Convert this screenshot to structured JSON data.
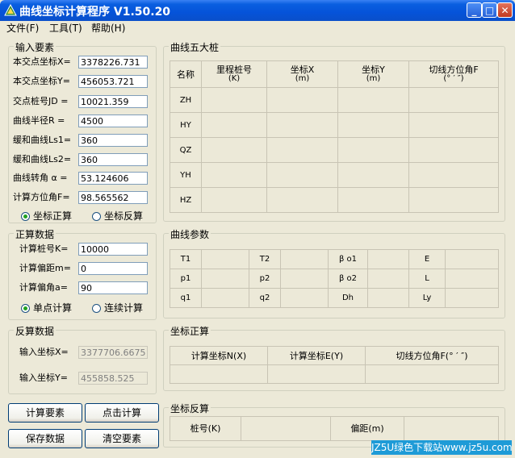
{
  "window": {
    "title": "曲线坐标计算程序 V1.50.20",
    "min_glyph": "_",
    "max_glyph": "□",
    "close_glyph": "✕"
  },
  "menu": [
    {
      "label": "文件(F)"
    },
    {
      "label": "工具(T)"
    },
    {
      "label": "帮助(H)"
    }
  ],
  "input_elements": {
    "title": "输入要素",
    "fields": [
      {
        "label": "本交点坐标X=",
        "value": "3378226.731"
      },
      {
        "label": "本交点坐标Y=",
        "value": "456053.721"
      },
      {
        "label": "交点桩号JD =",
        "value": "10021.359"
      },
      {
        "label": "曲线半径R   =",
        "value": "4500"
      },
      {
        "label": "缓和曲线Ls1=",
        "value": "360"
      },
      {
        "label": "缓和曲线Ls2=",
        "value": "360"
      },
      {
        "label": "曲线转角 α =",
        "value": "53.124606"
      },
      {
        "label": "计算方位角F=",
        "value": "98.565562"
      }
    ],
    "radio_forward": "坐标正算",
    "radio_inverse": "坐标反算",
    "selected": "forward"
  },
  "forward_data": {
    "title": "正算数据",
    "fields": [
      {
        "label": "计算桩号K=",
        "value": "10000"
      },
      {
        "label": "计算偏距m=",
        "value": "0"
      },
      {
        "label": "计算偏角a=",
        "value": "90"
      }
    ],
    "radio_single": "单点计算",
    "radio_continuous": "连续计算",
    "selected": "single"
  },
  "inverse_data": {
    "title": "反算数据",
    "fields": [
      {
        "label": "输入坐标X=",
        "value": "3377706.6675"
      },
      {
        "label": "输入坐标Y=",
        "value": "455858.525"
      }
    ]
  },
  "buttons": {
    "calc_elements": "计算要素",
    "click_calc": "点击计算",
    "save_data": "保存数据",
    "clear_elements": "清空要素"
  },
  "five_piles": {
    "title": "曲线五大桩",
    "headers": [
      {
        "l1": "名称",
        "l2": ""
      },
      {
        "l1": "里程桩号",
        "l2": "(K)"
      },
      {
        "l1": "坐标X",
        "l2": "(m)"
      },
      {
        "l1": "坐标Y",
        "l2": "(m)"
      },
      {
        "l1": "切线方位角F",
        "l2": "(° ′ ″)"
      }
    ],
    "rows": [
      "ZH",
      "HY",
      "QZ",
      "YH",
      "HZ"
    ]
  },
  "curve_params": {
    "title": "曲线参数",
    "rows": [
      [
        "T1",
        "",
        "T2",
        "",
        "β o1",
        "",
        "E",
        ""
      ],
      [
        "p1",
        "",
        "p2",
        "",
        "β o2",
        "",
        "L",
        ""
      ],
      [
        "q1",
        "",
        "q2",
        "",
        "Dh",
        "",
        "Ly",
        ""
      ]
    ]
  },
  "coord_forward": {
    "title": "坐标正算",
    "headers": [
      "计算坐标N(X)",
      "计算坐标E(Y)",
      "切线方位角F(° ′ ″)"
    ]
  },
  "coord_inverse": {
    "title": "坐标反算",
    "labels": [
      "桩号(K)",
      "",
      "偏距(m)",
      ""
    ]
  },
  "watermark": "JZ5U绿色下载站www.jz5u.com"
}
